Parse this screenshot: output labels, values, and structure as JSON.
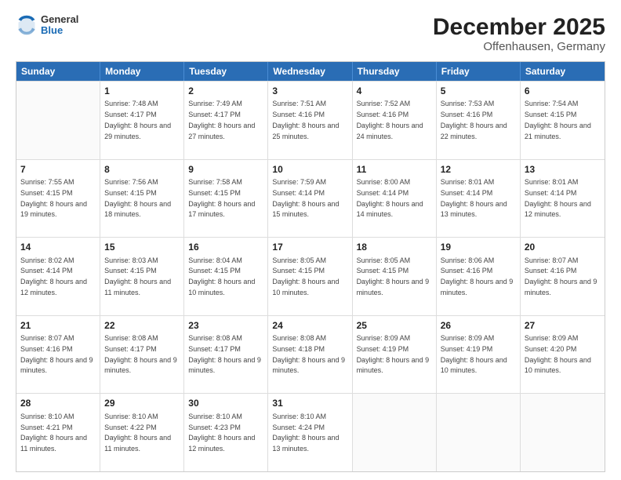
{
  "header": {
    "logo_general": "General",
    "logo_blue": "Blue",
    "title": "December 2025",
    "subtitle": "Offenhausen, Germany"
  },
  "calendar": {
    "days_of_week": [
      "Sunday",
      "Monday",
      "Tuesday",
      "Wednesday",
      "Thursday",
      "Friday",
      "Saturday"
    ],
    "rows": [
      [
        {
          "day": "",
          "sunrise": "",
          "sunset": "",
          "daylight": "",
          "empty": true
        },
        {
          "day": "1",
          "sunrise": "Sunrise: 7:48 AM",
          "sunset": "Sunset: 4:17 PM",
          "daylight": "Daylight: 8 hours and 29 minutes."
        },
        {
          "day": "2",
          "sunrise": "Sunrise: 7:49 AM",
          "sunset": "Sunset: 4:17 PM",
          "daylight": "Daylight: 8 hours and 27 minutes."
        },
        {
          "day": "3",
          "sunrise": "Sunrise: 7:51 AM",
          "sunset": "Sunset: 4:16 PM",
          "daylight": "Daylight: 8 hours and 25 minutes."
        },
        {
          "day": "4",
          "sunrise": "Sunrise: 7:52 AM",
          "sunset": "Sunset: 4:16 PM",
          "daylight": "Daylight: 8 hours and 24 minutes."
        },
        {
          "day": "5",
          "sunrise": "Sunrise: 7:53 AM",
          "sunset": "Sunset: 4:16 PM",
          "daylight": "Daylight: 8 hours and 22 minutes."
        },
        {
          "day": "6",
          "sunrise": "Sunrise: 7:54 AM",
          "sunset": "Sunset: 4:15 PM",
          "daylight": "Daylight: 8 hours and 21 minutes."
        }
      ],
      [
        {
          "day": "7",
          "sunrise": "Sunrise: 7:55 AM",
          "sunset": "Sunset: 4:15 PM",
          "daylight": "Daylight: 8 hours and 19 minutes."
        },
        {
          "day": "8",
          "sunrise": "Sunrise: 7:56 AM",
          "sunset": "Sunset: 4:15 PM",
          "daylight": "Daylight: 8 hours and 18 minutes."
        },
        {
          "day": "9",
          "sunrise": "Sunrise: 7:58 AM",
          "sunset": "Sunset: 4:15 PM",
          "daylight": "Daylight: 8 hours and 17 minutes."
        },
        {
          "day": "10",
          "sunrise": "Sunrise: 7:59 AM",
          "sunset": "Sunset: 4:14 PM",
          "daylight": "Daylight: 8 hours and 15 minutes."
        },
        {
          "day": "11",
          "sunrise": "Sunrise: 8:00 AM",
          "sunset": "Sunset: 4:14 PM",
          "daylight": "Daylight: 8 hours and 14 minutes."
        },
        {
          "day": "12",
          "sunrise": "Sunrise: 8:01 AM",
          "sunset": "Sunset: 4:14 PM",
          "daylight": "Daylight: 8 hours and 13 minutes."
        },
        {
          "day": "13",
          "sunrise": "Sunrise: 8:01 AM",
          "sunset": "Sunset: 4:14 PM",
          "daylight": "Daylight: 8 hours and 12 minutes."
        }
      ],
      [
        {
          "day": "14",
          "sunrise": "Sunrise: 8:02 AM",
          "sunset": "Sunset: 4:14 PM",
          "daylight": "Daylight: 8 hours and 12 minutes."
        },
        {
          "day": "15",
          "sunrise": "Sunrise: 8:03 AM",
          "sunset": "Sunset: 4:15 PM",
          "daylight": "Daylight: 8 hours and 11 minutes."
        },
        {
          "day": "16",
          "sunrise": "Sunrise: 8:04 AM",
          "sunset": "Sunset: 4:15 PM",
          "daylight": "Daylight: 8 hours and 10 minutes."
        },
        {
          "day": "17",
          "sunrise": "Sunrise: 8:05 AM",
          "sunset": "Sunset: 4:15 PM",
          "daylight": "Daylight: 8 hours and 10 minutes."
        },
        {
          "day": "18",
          "sunrise": "Sunrise: 8:05 AM",
          "sunset": "Sunset: 4:15 PM",
          "daylight": "Daylight: 8 hours and 9 minutes."
        },
        {
          "day": "19",
          "sunrise": "Sunrise: 8:06 AM",
          "sunset": "Sunset: 4:16 PM",
          "daylight": "Daylight: 8 hours and 9 minutes."
        },
        {
          "day": "20",
          "sunrise": "Sunrise: 8:07 AM",
          "sunset": "Sunset: 4:16 PM",
          "daylight": "Daylight: 8 hours and 9 minutes."
        }
      ],
      [
        {
          "day": "21",
          "sunrise": "Sunrise: 8:07 AM",
          "sunset": "Sunset: 4:16 PM",
          "daylight": "Daylight: 8 hours and 9 minutes."
        },
        {
          "day": "22",
          "sunrise": "Sunrise: 8:08 AM",
          "sunset": "Sunset: 4:17 PM",
          "daylight": "Daylight: 8 hours and 9 minutes."
        },
        {
          "day": "23",
          "sunrise": "Sunrise: 8:08 AM",
          "sunset": "Sunset: 4:17 PM",
          "daylight": "Daylight: 8 hours and 9 minutes."
        },
        {
          "day": "24",
          "sunrise": "Sunrise: 8:08 AM",
          "sunset": "Sunset: 4:18 PM",
          "daylight": "Daylight: 8 hours and 9 minutes."
        },
        {
          "day": "25",
          "sunrise": "Sunrise: 8:09 AM",
          "sunset": "Sunset: 4:19 PM",
          "daylight": "Daylight: 8 hours and 9 minutes."
        },
        {
          "day": "26",
          "sunrise": "Sunrise: 8:09 AM",
          "sunset": "Sunset: 4:19 PM",
          "daylight": "Daylight: 8 hours and 10 minutes."
        },
        {
          "day": "27",
          "sunrise": "Sunrise: 8:09 AM",
          "sunset": "Sunset: 4:20 PM",
          "daylight": "Daylight: 8 hours and 10 minutes."
        }
      ],
      [
        {
          "day": "28",
          "sunrise": "Sunrise: 8:10 AM",
          "sunset": "Sunset: 4:21 PM",
          "daylight": "Daylight: 8 hours and 11 minutes."
        },
        {
          "day": "29",
          "sunrise": "Sunrise: 8:10 AM",
          "sunset": "Sunset: 4:22 PM",
          "daylight": "Daylight: 8 hours and 11 minutes."
        },
        {
          "day": "30",
          "sunrise": "Sunrise: 8:10 AM",
          "sunset": "Sunset: 4:23 PM",
          "daylight": "Daylight: 8 hours and 12 minutes."
        },
        {
          "day": "31",
          "sunrise": "Sunrise: 8:10 AM",
          "sunset": "Sunset: 4:24 PM",
          "daylight": "Daylight: 8 hours and 13 minutes."
        },
        {
          "day": "",
          "sunrise": "",
          "sunset": "",
          "daylight": "",
          "empty": true
        },
        {
          "day": "",
          "sunrise": "",
          "sunset": "",
          "daylight": "",
          "empty": true
        },
        {
          "day": "",
          "sunrise": "",
          "sunset": "",
          "daylight": "",
          "empty": true
        }
      ]
    ]
  }
}
